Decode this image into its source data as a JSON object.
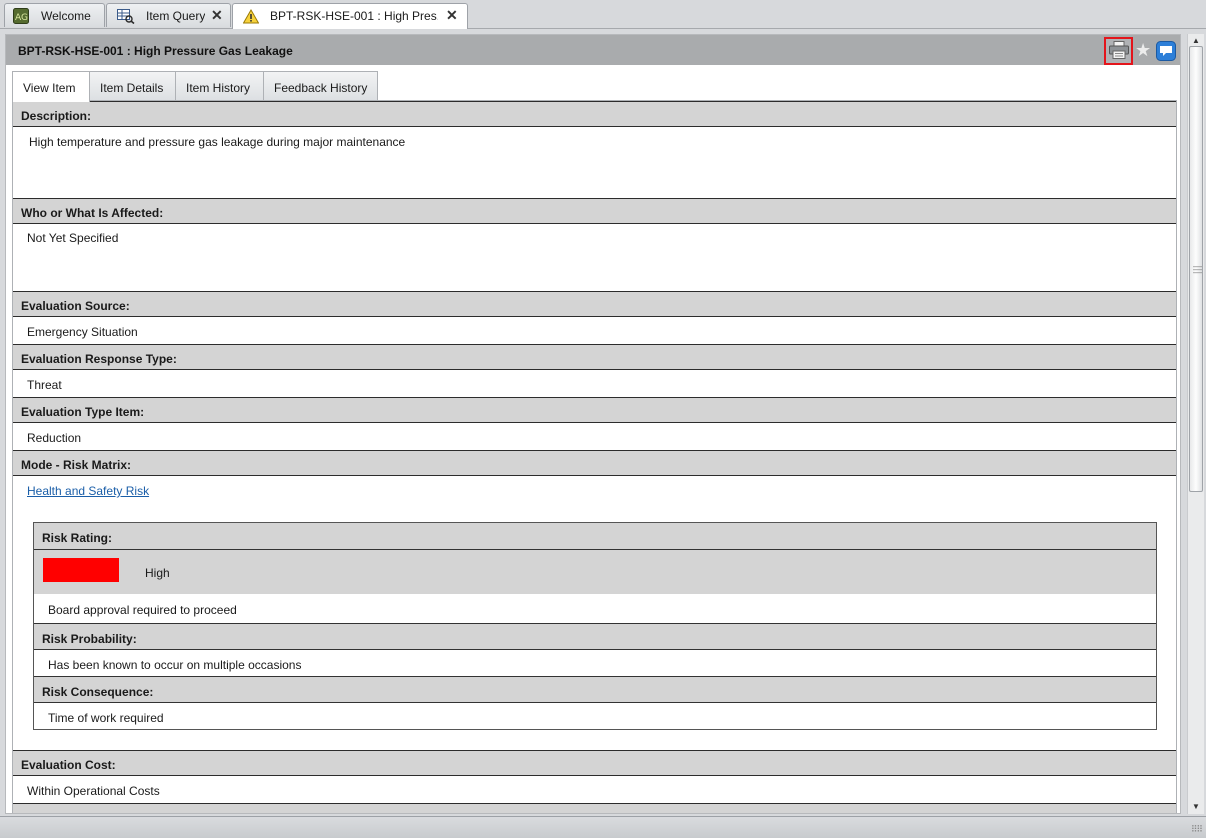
{
  "doc_tabs": [
    {
      "label": "Welcome",
      "icon": "app-logo-icon"
    },
    {
      "label": "Item Query",
      "icon": "query-grid-icon"
    },
    {
      "label": "BPT-RSK-HSE-001 : High Pres...",
      "icon": "warning-icon"
    }
  ],
  "header": {
    "title": "BPT-RSK-HSE-001 : High Pressure Gas Leakage",
    "print_icon": "print-icon",
    "favorite_icon": "star-icon",
    "comment_icon": "comment-icon"
  },
  "view_tabs": [
    "View Item",
    "Item Details",
    "Item History",
    "Feedback History"
  ],
  "sections": {
    "description": {
      "label": "Description:",
      "value": "High temperature and pressure gas leakage during major maintenance"
    },
    "affected": {
      "label": "Who or What Is Affected:",
      "value": "Not Yet Specified"
    },
    "source": {
      "label": "Evaluation Source:",
      "value": "Emergency Situation"
    },
    "response_type": {
      "label": "Evaluation Response Type:",
      "value": "Threat"
    },
    "type_item": {
      "label": "Evaluation Type Item:",
      "value": "Reduction"
    },
    "risk_matrix": {
      "label": "Mode - Risk Matrix:",
      "value": "Health and Safety Risk"
    },
    "cost": {
      "label": "Evaluation Cost:",
      "value": "Within Operational Costs"
    }
  },
  "risk": {
    "rating_label": "Risk Rating:",
    "rating": "High",
    "rating_color": "#ff0000",
    "rating_note": "Board approval required to proceed",
    "probability_label": "Risk Probability:",
    "probability": "Has been known to occur on multiple occasions",
    "consequence_label": "Risk Consequence:",
    "consequence": "Time of work required"
  }
}
